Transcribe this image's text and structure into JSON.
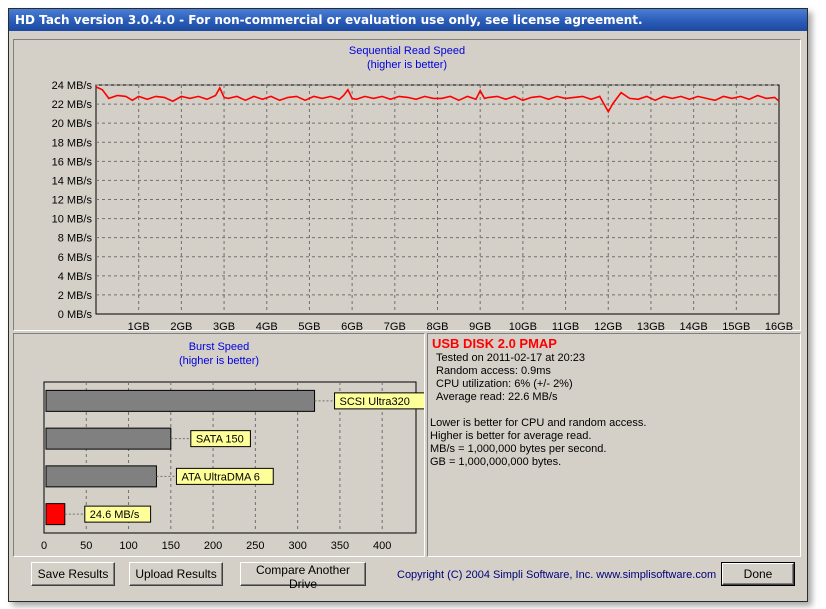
{
  "window": {
    "title": "HD Tach version 3.0.4.0  - For non-commercial or evaluation use only, see license agreement."
  },
  "sequential": {
    "title": "Sequential Read Speed",
    "subtitle": "(higher is better)",
    "chart_data": {
      "type": "line",
      "y_tick_labels": [
        "0 MB/s",
        "2 MB/s",
        "4 MB/s",
        "6 MB/s",
        "8 MB/s",
        "10 MB/s",
        "12 MB/s",
        "14 MB/s",
        "16 MB/s",
        "18 MB/s",
        "20 MB/s",
        "22 MB/s",
        "24 MB/s"
      ],
      "x_tick_labels": [
        "1GB",
        "2GB",
        "3GB",
        "4GB",
        "5GB",
        "6GB",
        "7GB",
        "8GB",
        "9GB",
        "10GB",
        "11GB",
        "12GB",
        "13GB",
        "14GB",
        "15GB",
        "16GB"
      ],
      "ylim": [
        0,
        24
      ],
      "xlim": [
        0,
        16
      ],
      "grid": true,
      "line_color": "#ff0000",
      "x": [
        0,
        0.15,
        0.3,
        0.5,
        0.7,
        0.85,
        1.0,
        1.2,
        1.4,
        1.6,
        1.8,
        2.0,
        2.2,
        2.4,
        2.6,
        2.8,
        2.9,
        3.0,
        3.1,
        3.3,
        3.5,
        3.7,
        3.9,
        4.1,
        4.3,
        4.5,
        4.7,
        4.9,
        5.1,
        5.3,
        5.5,
        5.7,
        5.8,
        5.9,
        6.0,
        6.1,
        6.3,
        6.5,
        6.7,
        6.9,
        7.1,
        7.3,
        7.5,
        7.7,
        7.9,
        8.1,
        8.3,
        8.5,
        8.7,
        8.9,
        9.0,
        9.1,
        9.2,
        9.4,
        9.6,
        9.8,
        10.0,
        10.2,
        10.4,
        10.6,
        10.8,
        11.0,
        11.2,
        11.4,
        11.6,
        11.8,
        11.9,
        12.0,
        12.1,
        12.3,
        12.5,
        12.7,
        12.9,
        13.1,
        13.3,
        13.5,
        13.7,
        13.9,
        14.1,
        14.3,
        14.5,
        14.7,
        14.9,
        15.1,
        15.3,
        15.5,
        15.7,
        15.9,
        16.0
      ],
      "values": [
        23.8,
        23.5,
        22.6,
        22.9,
        22.8,
        22.4,
        22.8,
        22.5,
        22.8,
        22.7,
        22.3,
        22.8,
        22.6,
        22.8,
        22.5,
        22.9,
        23.7,
        22.7,
        22.6,
        22.8,
        22.4,
        22.8,
        22.5,
        22.8,
        22.4,
        22.7,
        22.8,
        22.4,
        22.8,
        22.6,
        22.8,
        22.5,
        22.9,
        23.5,
        22.6,
        22.5,
        22.8,
        22.6,
        22.8,
        22.5,
        22.8,
        22.7,
        22.5,
        22.8,
        22.6,
        22.6,
        22.8,
        22.4,
        22.8,
        22.5,
        23.4,
        22.6,
        22.7,
        22.8,
        22.5,
        22.8,
        22.4,
        22.7,
        22.8,
        22.5,
        22.8,
        22.6,
        22.7,
        22.8,
        22.5,
        22.8,
        22.0,
        21.2,
        22.0,
        23.2,
        22.6,
        22.5,
        22.8,
        22.4,
        22.8,
        22.6,
        22.8,
        22.5,
        22.8,
        22.6,
        22.4,
        22.8,
        22.6,
        22.8,
        22.5,
        22.9,
        22.6,
        22.7,
        22.3
      ]
    }
  },
  "burst": {
    "title": "Burst Speed",
    "subtitle": "(higher is better)",
    "chart_data": {
      "type": "bar",
      "orientation": "horizontal",
      "categories": [
        "SCSI Ultra320",
        "SATA 150",
        "ATA UltraDMA 6",
        "24.6 MB/s"
      ],
      "values": [
        320,
        150,
        133,
        24.6
      ],
      "colors": [
        "#808080",
        "#808080",
        "#808080",
        "#ff0000"
      ],
      "xlim": [
        0,
        440
      ],
      "x_tick_labels": [
        "0",
        "50",
        "100",
        "150",
        "200",
        "250",
        "300",
        "350",
        "400"
      ],
      "x_tick_values": [
        0,
        50,
        100,
        150,
        200,
        250,
        300,
        350,
        400
      ],
      "label_box_color": "#ffff99"
    }
  },
  "info": {
    "drive_name": "USB DISK 2.0 PMAP",
    "tested_on": "Tested on 2011-02-17 at 20:23",
    "random_access": "Random access: 0.9ms",
    "cpu_utilization": "CPU utilization: 6% (+/- 2%)",
    "average_read": "Average read: 22.6 MB/s",
    "note_1": "Lower is better for CPU and random access.",
    "note_2": "Higher is better for average read.",
    "note_3": "MB/s = 1,000,000 bytes per second.",
    "note_4": "GB = 1,000,000,000 bytes."
  },
  "buttons": {
    "save": "Save Results",
    "upload": "Upload Results",
    "compare": "Compare Another Drive",
    "done": "Done"
  },
  "copyright": "Copyright (C) 2004 Simpli Software, Inc. www.simplisoftware.com"
}
